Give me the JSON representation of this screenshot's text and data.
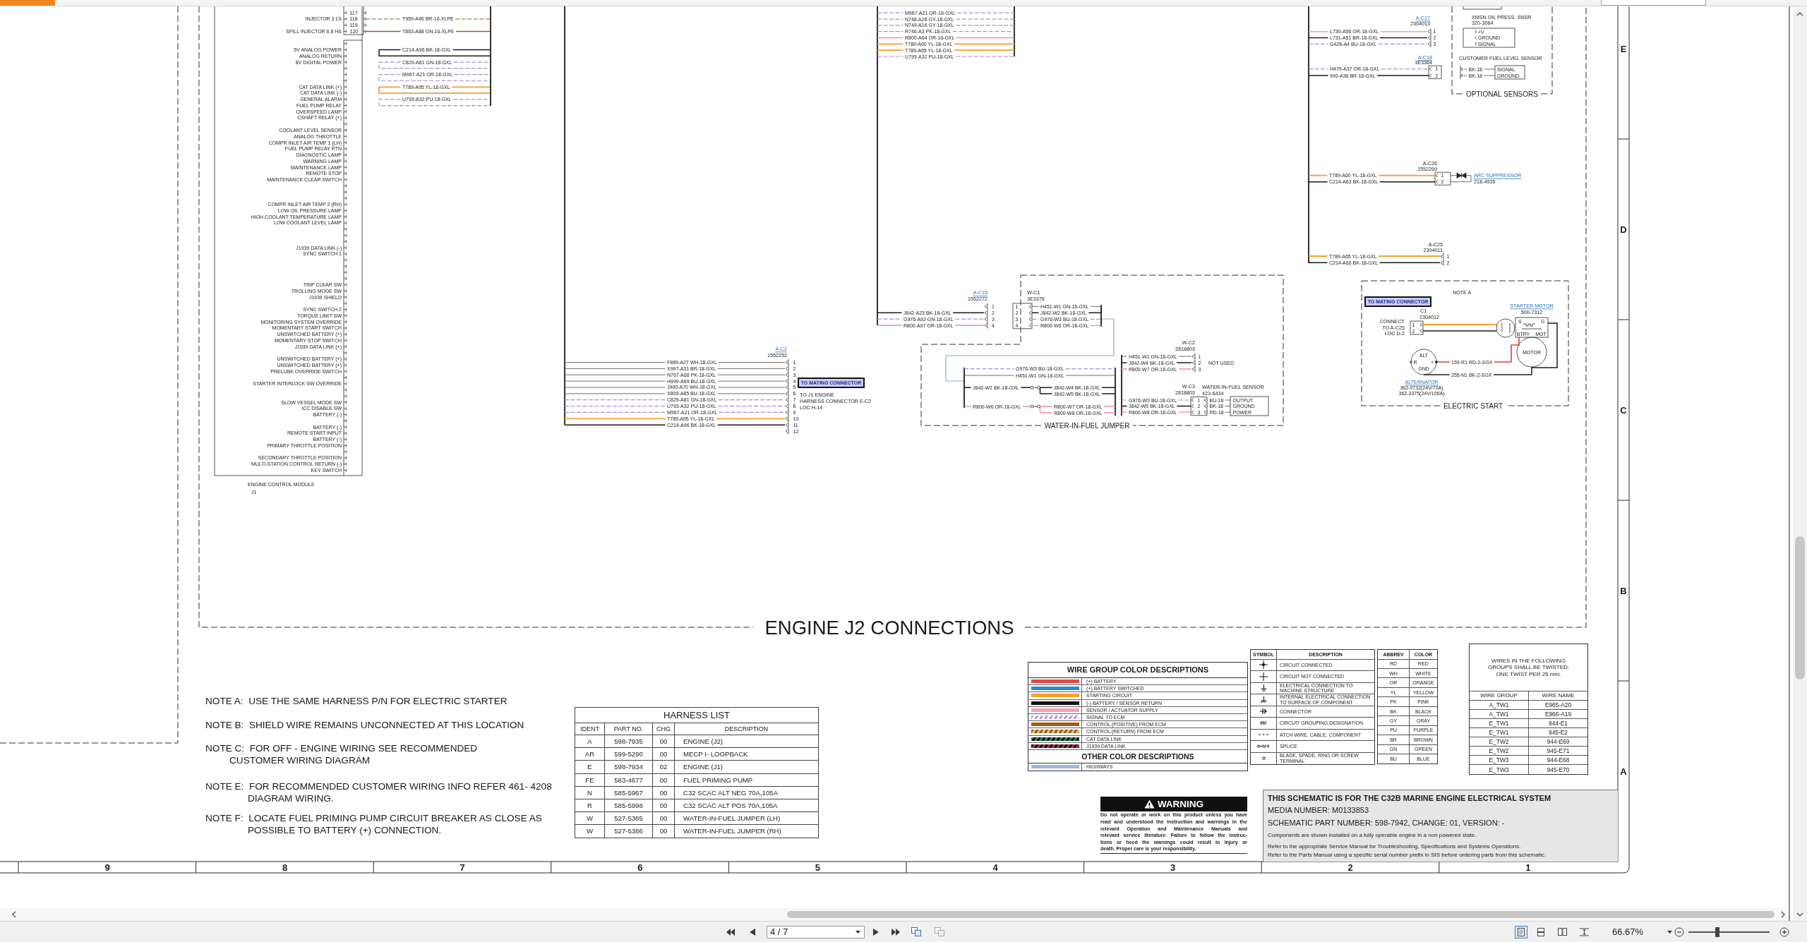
{
  "schematic": {
    "title": "ENGINE J2 CONNECTIONS",
    "ecm": {
      "title": "ENGINE CONTROL MODULE",
      "designator": "J1",
      "injector_pins": [
        {
          "number": "117"
        },
        {
          "number": "118",
          "label": "INJECTOR 3 LS"
        },
        {
          "number": "119"
        },
        {
          "number": "120",
          "label": "SPILL INJECTOR 6,8 HS"
        }
      ],
      "pins": [
        "5V ANALOG POWER",
        "ANALOG RETURN",
        "8V DIGITAL POWER",
        "CAT DATA LINK (+)",
        "CAT DATA LINK (-)",
        "GENERAL ALARM",
        "FUEL PUMP RELAY",
        "OVERSPEED LAMP",
        "CSHAFT RELAY (+)",
        "COOLANT LEVEL SENSOR",
        "ANALOG THROTTLE",
        "COMPR INLET AIR TEMP 1 (LH)",
        "FUEL PUMP RELAY RTN",
        "DIAGNOSTIC LAMP",
        "WARNING LAMP",
        "MAINTENANCE LAMP",
        "REMOTE STOP",
        "MAINTENANCE CLEAR SWITCH",
        "COMPR INLET AIR TEMP 2 (RH)",
        "LOW OIL PRESSURE LAMP",
        "HIGH COOLANT TEMPERATURE LAMP",
        "LOW COOLANT LEVEL LAMP",
        "J1939 DATA LINK (-)",
        "SYNC SWITCH 1",
        "TRIP CLEAR SW",
        "TROLLING MODE SW",
        "J1939 SHIELD",
        "SYNC SWITCH 2",
        "TORQUE LIMIT SW",
        "MONITORING SYSTEM OVERRIDE",
        "MOMENTARY START SWITCH",
        "UNSWITCHED BATTERY (+)",
        "MOMENTARY STOP SWITCH",
        "J1939 DATA LINK (+)",
        "UNSWITCHED BATTERY (+)",
        "UNSWITCHED BATTERY (+)",
        "PRELUBE OVERRIDE SWITCH",
        "STARTER INTERLOCK SW OVERRIDE",
        "SLOW VESSEL MODE SW",
        "ICC DISABLE SW",
        "BATTERY (-)",
        "BATTERY (-)",
        "REMOTE START INPUT",
        "BATTERY (-)",
        "PRIMARY THROTTLE POSITION",
        "SECONDARY THROTTLE POSITION",
        "MULTI-STATION CONTROL RETURN (-)",
        "KEY SWITCH"
      ]
    },
    "injector_wires": [
      {
        "label": "T959-A46 BR-16-XLPE",
        "kind": "control-return"
      },
      {
        "label": "T863-A88 GN-16-XLPE",
        "kind": "control-positive"
      }
    ],
    "ecm_bus_wires": [
      {
        "label": "C214-A96 BK-18-GXL",
        "kind": "return"
      },
      {
        "label": "C829-A81 GN-18-GXL",
        "kind": "signal"
      },
      {
        "label": "M967-A21 OR-18-GXL",
        "kind": "signal"
      },
      {
        "label": "T789-A95 YL-18-GXL",
        "kind": "starting"
      },
      {
        "label": "U793-A32 PU-18-GXL",
        "kind": "signal"
      }
    ],
    "harness_wires": [
      {
        "label": "M967-A21 OR-18-GXL",
        "kind": "signal"
      },
      {
        "label": "N748-A28 GY-18-GXL",
        "kind": "signal"
      },
      {
        "label": "N749-A16 GY-18-GXL",
        "kind": "signal"
      },
      {
        "label": "R746-A3 PK-18-GXL",
        "kind": "signal"
      },
      {
        "label": "R800-A64 OR-18-GXL",
        "kind": "supply"
      },
      {
        "label": "T789-A60 YL-18-GXL",
        "kind": "starting"
      },
      {
        "label": "T789-A65 YL-18-GXL",
        "kind": "starting"
      },
      {
        "label": "U793-A32 PU-18-GXL",
        "kind": "signal"
      }
    ],
    "connectors": [
      {
        "name": "A-C2",
        "link": true,
        "part": "1552252",
        "tag": "TO MATING CONNECTOR",
        "note": [
          "TO J1 ENGINE",
          "HARNESS CONNECTOR E-C2",
          "LOC H-14"
        ],
        "pins": [
          {
            "number": "1",
            "wire": {
              "label": "F889-A27 WH-18-GXL",
              "kind": "plain"
            }
          },
          {
            "number": "2",
            "wire": {
              "label": "X997-A31 BR-18-GXL",
              "kind": "plain"
            }
          },
          {
            "number": "3",
            "wire": {
              "label": "N767-A68 PK-18-GXL",
              "kind": "plain"
            }
          },
          {
            "number": "4",
            "wire": {
              "label": "H999-A69 BU-18-GXL",
              "kind": "plain"
            }
          },
          {
            "number": "5",
            "wire": {
              "label": "J900-A70 WH-18-GXL",
              "kind": "plain"
            }
          },
          {
            "number": "6",
            "wire": {
              "label": "X809-A85 BU-18-GXL",
              "kind": "plain"
            }
          },
          {
            "number": "7",
            "wire": {
              "label": "C829-A81 GN-18-GXL",
              "kind": "signal"
            }
          },
          {
            "number": "8",
            "wire": {
              "label": "U793-A32 PU-18-GXL",
              "kind": "signal"
            }
          },
          {
            "number": "9",
            "wire": {
              "label": "M967-A21 OR-18-GXL",
              "kind": "signal"
            }
          },
          {
            "number": "10",
            "wire": {
              "label": "T789-A95 YL-18-GXL",
              "kind": "starting"
            }
          },
          {
            "number": "11",
            "wire": {
              "label": "C214-A96 BK-18-GXL",
              "kind": "return"
            }
          },
          {
            "number": "12"
          }
        ]
      },
      {
        "name": "A-C15",
        "link": true,
        "part": "1552272",
        "pins": [
          {
            "number": "1"
          },
          {
            "number": "2",
            "wire": {
              "label": "J842-A23 BK-18-GXL",
              "kind": "return"
            }
          },
          {
            "number": "3",
            "wire": {
              "label": "G976-A92 GN-18-GXL",
              "kind": "signal"
            }
          },
          {
            "number": "4",
            "wire": {
              "label": "R800-A97 OR-18-GXL",
              "kind": "supply"
            }
          }
        ]
      },
      {
        "name": "A-C17",
        "link": true,
        "part": "2304013",
        "pins": [
          {
            "number": "1",
            "wire": {
              "label": "L730-A56 OR-18-GXL",
              "kind": "supply"
            }
          },
          {
            "number": "2",
            "wire": {
              "label": "L731-A51 BR-18-GXL",
              "kind": "return"
            }
          },
          {
            "number": "3",
            "wire": {
              "label": "G428-A4 BU-18-GXL",
              "kind": "signal"
            }
          }
        ]
      },
      {
        "name": "A-C18",
        "link": true,
        "part": "3E3364",
        "pins": [
          {
            "number": "1",
            "wire": {
              "label": "H479-A37 OR-18-GXL",
              "kind": "signal"
            }
          },
          {
            "number": "2",
            "wire": {
              "label": "993-A36 BR-18-GXL",
              "kind": "return"
            }
          }
        ]
      },
      {
        "name": "A-C26",
        "link": false,
        "part": "1552269",
        "pins": [
          {
            "number": "1",
            "wire": {
              "label": "T789-A60 YL-18-GXL",
              "kind": "starting"
            }
          },
          {
            "number": "2",
            "wire": {
              "label": "C214-A63 BK-18-GXL",
              "kind": "return"
            }
          }
        ]
      },
      {
        "name": "A-C25",
        "link": false,
        "part": "2304011",
        "pins": [
          {
            "number": "1",
            "wire": {
              "label": "T789-A65 YL-18-GXL",
              "kind": "starting"
            }
          },
          {
            "number": "2",
            "wire": {
              "label": "C214-A66 BK-18-GXL",
              "kind": "return"
            }
          }
        ]
      }
    ],
    "arc_suppressor": {
      "name": "ARC SUPPRESSOR",
      "part": "218-4935"
    },
    "optional_sensors": {
      "title": "OPTIONAL SENSORS",
      "transmission_sensor": {
        "name": "XMSN OIL PRESS. SNSR",
        "part": "320-3064",
        "terminals": [
          "+V",
          "GROUND",
          "SIGNAL"
        ]
      },
      "fuel_level_sensor": {
        "name": "CUSTOMER FUEL LEVEL SENSOR",
        "leads": [
          "BK-18",
          "BK-18"
        ],
        "terminals": [
          "SIGNAL",
          "GROUND"
        ]
      }
    },
    "water_in_fuel_jumper": {
      "title": "WATER-IN-FUEL JUMPER",
      "connectors": [
        {
          "name": "W-C1",
          "part": "3E3376",
          "pins": [
            {
              "number": "1",
              "wire": {
                "label": "H451-W1 GN-18-GXL",
                "kind": "plain"
              }
            },
            {
              "number": "2",
              "wire": {
                "label": "J842-W2 BK-18-GXL",
                "kind": "return"
              }
            },
            {
              "number": "3",
              "wire": {
                "label": "G976-W3 BU-18-GXL",
                "kind": "signal"
              }
            },
            {
              "number": "4",
              "wire": {
                "label": "R800-W6 OR-18-GXL",
                "kind": "supply"
              }
            }
          ]
        },
        {
          "name": "W-C2",
          "part": "2818803",
          "note": "NOT USED",
          "pins": [
            {
              "number": "1",
              "wire": {
                "label": "H451-W1 GN-18-GXL",
                "kind": "plain"
              }
            },
            {
              "number": "2",
              "wire": {
                "label": "J842-W4 BK-18-GXL",
                "kind": "return"
              }
            },
            {
              "number": "3",
              "wire": {
                "label": "R800-W7 OR-18-GXL",
                "kind": "supply"
              }
            }
          ]
        },
        {
          "name": "W-C3",
          "part": "2818803",
          "sensor": {
            "name": "WATER-IN-FUEL SENSOR",
            "part": "423-6434",
            "leads": [
              "BU-18",
              "BK-18",
              "RD-18"
            ],
            "terminals": [
              "OUTPUT",
              "GROUND",
              "POWER"
            ]
          },
          "pins": [
            {
              "number": "1",
              "wire": {
                "label": "G976-W3 BU-18-GXL",
                "kind": "signal"
              }
            },
            {
              "number": "2",
              "wire": {
                "label": "J842-W5 BK-18-GXL",
                "kind": "return"
              }
            },
            {
              "number": "3",
              "wire": {
                "label": "R800-W8 OR-18-GXL",
                "kind": "supply"
              }
            }
          ]
        }
      ],
      "wires": [
        {
          "label": "G976-W3 BU-18-GXL",
          "kind": "signal"
        },
        {
          "label": "H451-W1 GN-18-GXL",
          "kind": "plain"
        },
        {
          "label": "J842-W2 BK-18-GXL",
          "kind": "return"
        },
        {
          "label": "J842-W4 BK-18-GXL",
          "kind": "return"
        },
        {
          "label": "J842-W5 BK-18-GXL",
          "kind": "return"
        },
        {
          "label": "R800-W6 OR-18-GXL",
          "kind": "supply"
        },
        {
          "label": "R800-W7 OR-18-GXL",
          "kind": "supply"
        },
        {
          "label": "R800-W8 OR-18-GXL",
          "kind": "supply"
        }
      ]
    },
    "electric_start": {
      "title": "ELECTRIC START",
      "note": "NOTE A",
      "tag": "TO MATING CONNECTOR",
      "connector": {
        "name": "C1",
        "part": "2304012",
        "pins": [
          {
            "number": "1"
          },
          {
            "number": "2"
          }
        ],
        "note": [
          "CONNECT",
          "TO A-C25",
          "LOC D-2"
        ]
      },
      "starter_motor": {
        "name": "STARTER MOTOR",
        "part": "500-7312",
        "terminals": [
          "S",
          "G",
          "BTRY",
          "MOT"
        ],
        "label": "MOTOR"
      },
      "alternator": {
        "name": "ALTERNATOR",
        "parts": [
          "362-0732(24V/70A)",
          "362-3375(24V/105A)"
        ],
        "terminals": [
          "ALT",
          "R",
          "+",
          "GND"
        ]
      },
      "wires": [
        {
          "label": "159-R1 RD-2-SGX",
          "kind": "battery"
        },
        {
          "label": "255-N1 BK-2-SGX",
          "kind": "return"
        }
      ]
    }
  },
  "zones": {
    "rows": [
      "E",
      "D",
      "C",
      "B",
      "A"
    ],
    "columns": [
      "9",
      "8",
      "7",
      "6",
      "5",
      "4",
      "3",
      "2",
      "1"
    ]
  },
  "notes": [
    {
      "lines": [
        "NOTE A:  USE THE SAME HARNESS P/N FOR ELECTRIC STARTER"
      ]
    },
    {
      "lines": [
        "NOTE B:  SHIELD WIRE REMAINS UNCONNECTED AT THIS LOCATION"
      ]
    },
    {
      "lines": [
        "NOTE C:  FOR OFF - ENGINE WIRING SEE RECOMMENDED",
        "CUSTOMER WIRING DIAGRAM"
      ]
    },
    {
      "lines": [
        "NOTE E:  FOR RECOMMENDED CUSTOMER WIRING INFO REFER 461- 4208",
        "DIAGRAM WIRING."
      ]
    },
    {
      "lines": [
        "NOTE F:  LOCATE FUEL PRIMING PUMP CIRCUIT BREAKER AS CLOSE AS",
        "POSSIBLE TO BATTERY (+) CONNECTION."
      ]
    }
  ],
  "harness_list": {
    "title": "HARNESS LIST",
    "columns": [
      "IDENT",
      "PART NO.",
      "CHG",
      "DESCRIPTION"
    ],
    "rows": [
      [
        "A",
        "598-7935",
        "00",
        "ENGINE (J2)"
      ],
      [
        "AR",
        "599-5290",
        "00",
        "MECP I- LOOPBACK"
      ],
      [
        "E",
        "598-7934",
        "02",
        "ENGINE (J1)"
      ],
      [
        "FE",
        "583-4677",
        "00",
        "FUEL PRIMING PUMP"
      ],
      [
        "N",
        "585-5967",
        "00",
        "C32 SCAC ALT NEG 70A,105A"
      ],
      [
        "R",
        "585-5998",
        "00",
        "C32 SCAC ALT POS 70A,105A"
      ],
      [
        "W",
        "527-5385",
        "00",
        "WATER-IN-FUEL JUMPER (LH)"
      ],
      [
        "W",
        "527-5386",
        "00",
        "WATER-IN-FUEL JUMPER (RH)"
      ]
    ]
  },
  "wire_group_colors": {
    "title": "WIRE GROUP COLOR DESCRIPTIONS",
    "items": [
      {
        "label": "(+) BATTERY",
        "color": "#e8453c"
      },
      {
        "label": "(+) BATTERY SWITCHED",
        "color": "#1f8fd2"
      },
      {
        "label": "STARTING CIRCUIT",
        "color": "#f6a02d"
      },
      {
        "label": "(-) BATTERY / SENSOR RETURN",
        "color": "#111111"
      },
      {
        "label": "SENSOR / ACTUATOR SUPPLY",
        "color": "#f2a2b2"
      },
      {
        "label": "SIGNAL TO ECM",
        "stripes": [
          {
            "color": "#b79be0"
          },
          {
            "color": "#ffffff"
          }
        ]
      },
      {
        "label": "CONTROL (POSITIVE) FROM ECM",
        "color": "#9c5d12"
      },
      {
        "label": "CONTROL (RETURN) FROM ECM",
        "stripes": [
          {
            "color": "#9c5d12"
          },
          {
            "color": "#d9c08a"
          }
        ]
      },
      {
        "label": "CAT DATA LINK",
        "stripes": [
          {
            "color": "#1f8a5a"
          },
          {
            "color": "#111111"
          }
        ]
      },
      {
        "label": "J1939 DATA LINK",
        "stripes": [
          {
            "color": "#111111"
          },
          {
            "color": "#c8283c"
          }
        ]
      }
    ],
    "other_title": "OTHER COLOR DESCRIPTIONS",
    "other_items": [
      {
        "label": "HIGHWAYS",
        "color": "#9bb7df"
      }
    ]
  },
  "symbol_legend": {
    "columns": [
      "SYMBOL",
      "DESCRIPTION"
    ],
    "rows": [
      {
        "kind": "connected",
        "lines": [
          "CIRCUIT CONNECTED"
        ]
      },
      {
        "kind": "not-connected",
        "lines": [
          "CIRCUIT NOT CONNECTED"
        ]
      },
      {
        "kind": "ground",
        "lines": [
          "ELECTRICAL CONNECTION TO",
          "MACHINE STRUCTURE"
        ]
      },
      {
        "kind": "internal-ground",
        "lines": [
          "INTERNAL ELECTRICAL CONNECTION",
          "TO SURFACE OF COMPONENT"
        ]
      },
      {
        "kind": "connector",
        "lines": [
          "CONNECTOR"
        ]
      },
      {
        "kind": "text",
        "symbol": "H#",
        "lines": [
          "CIRCUIT GROUPING DESIGNATION"
        ]
      },
      {
        "kind": "dashed",
        "lines": [
          "ATCH WIRE, CABLE, COMPONENT"
        ]
      },
      {
        "kind": "splice",
        "lines": [
          "SPLICE"
        ]
      },
      {
        "kind": "terminal",
        "lines": [
          "BLADE, SPADE, RING OR SCREW",
          "TERMINAL"
        ]
      }
    ]
  },
  "color_abbreviations": {
    "columns": [
      "ABBREV",
      "COLOR"
    ],
    "rows": [
      [
        "RD",
        "RED"
      ],
      [
        "WH",
        "WHITE"
      ],
      [
        "OR",
        "ORANGE"
      ],
      [
        "YL",
        "YELLOW"
      ],
      [
        "PK",
        "PINK"
      ],
      [
        "BK",
        "BLACK"
      ],
      [
        "GY",
        "GRAY"
      ],
      [
        "PU",
        "PURPLE"
      ],
      [
        "BR",
        "BROWN"
      ],
      [
        "GN",
        "GREEN"
      ],
      [
        "BU",
        "BLUE"
      ]
    ]
  },
  "twisted_wires": {
    "heading": [
      "WIRES IN THE FOLLOWING",
      "GROUPS SHALL BE TWISTED:",
      "ONE TWIST PER 25 mm."
    ],
    "columns": [
      "WIRE GROUP",
      "WIRE NAME"
    ],
    "rows": [
      [
        "A_TW1",
        "E965-A20"
      ],
      [
        "A_TW1",
        "E966-A19"
      ],
      [
        "E_TW1",
        "944-E1"
      ],
      [
        "E_TW1",
        "945-E2"
      ],
      [
        "E_TW2",
        "944-E69"
      ],
      [
        "E_TW2",
        "945-E71"
      ],
      [
        "E_TW3",
        "944-E68"
      ],
      [
        "E_TW3",
        "945-E70"
      ]
    ]
  },
  "warning": {
    "title": "WARNING",
    "lines": [
      "Do not operate or work on this product unless you have",
      "read and understood the instruction and warnings in the",
      "relevant Operation and Maintenance Manuals and",
      "relevant service literature. Failure to follow the instruc-",
      "tions or heed the warnings could result in injury or",
      "death. Proper care is your responsibility."
    ]
  },
  "title_block": {
    "heading": "THIS SCHEMATIC IS FOR THE C32B MARINE ENGINE ELECTRICAL SYSTEM",
    "media_number": "MEDIA NUMBER: M0133853",
    "part_number": "SCHEMATIC PART NUMBER: 598-7942, CHANGE: 01, VERSION: -",
    "remarks": [
      "Components are shown installed on a fully operable engine in a non powered state.",
      "Refer to the appropriate Service Manual for Troubleshooting, Specifications and Systems Operations.",
      "Refer to the Parts Manual using a specific serial number prefix in SIS before ordering parts from this schematic."
    ]
  },
  "status_bar": {
    "page": "4 / 7",
    "view_modes": [
      {
        "selected": true
      },
      {
        "selected": false
      },
      {
        "selected": false
      },
      {
        "selected": false
      }
    ],
    "zoom": "66.67%",
    "zoom_slider": {
      "level": 0.36
    }
  }
}
